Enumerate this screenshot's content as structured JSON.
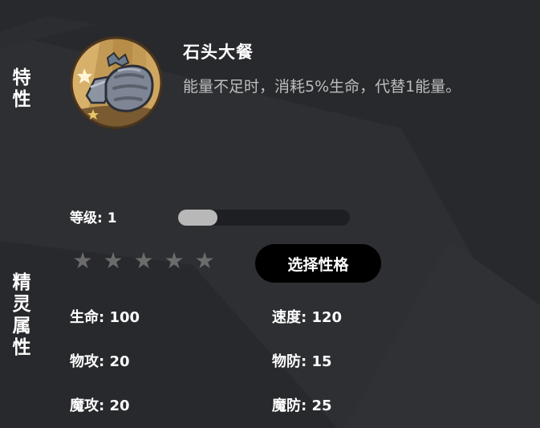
{
  "side_labels": {
    "trait": [
      "特",
      "性"
    ],
    "attributes": [
      "精",
      "灵",
      "属",
      "性"
    ]
  },
  "trait": {
    "icon": "stone-meal-icon",
    "name": "石头大餐",
    "description": "能量不足时，消耗5%生命，代替1能量。"
  },
  "level": {
    "label": "等级: 1",
    "progress": 0.23
  },
  "stars": {
    "total": 5,
    "filled": 0,
    "glyph": "★",
    "empty_color": "#6b6b6b"
  },
  "select_button": {
    "label": "选择性格"
  },
  "stats": {
    "hp": "生命: 100",
    "speed": "速度: 120",
    "phys_atk": "物攻: 20",
    "phys_def": "物防: 15",
    "mag_atk": "魔攻: 20",
    "mag_def": "魔防: 25"
  },
  "colors": {
    "background": "#28292c",
    "track": "#1e1f22",
    "progress": "#b8b8b8",
    "button": "#000000"
  }
}
